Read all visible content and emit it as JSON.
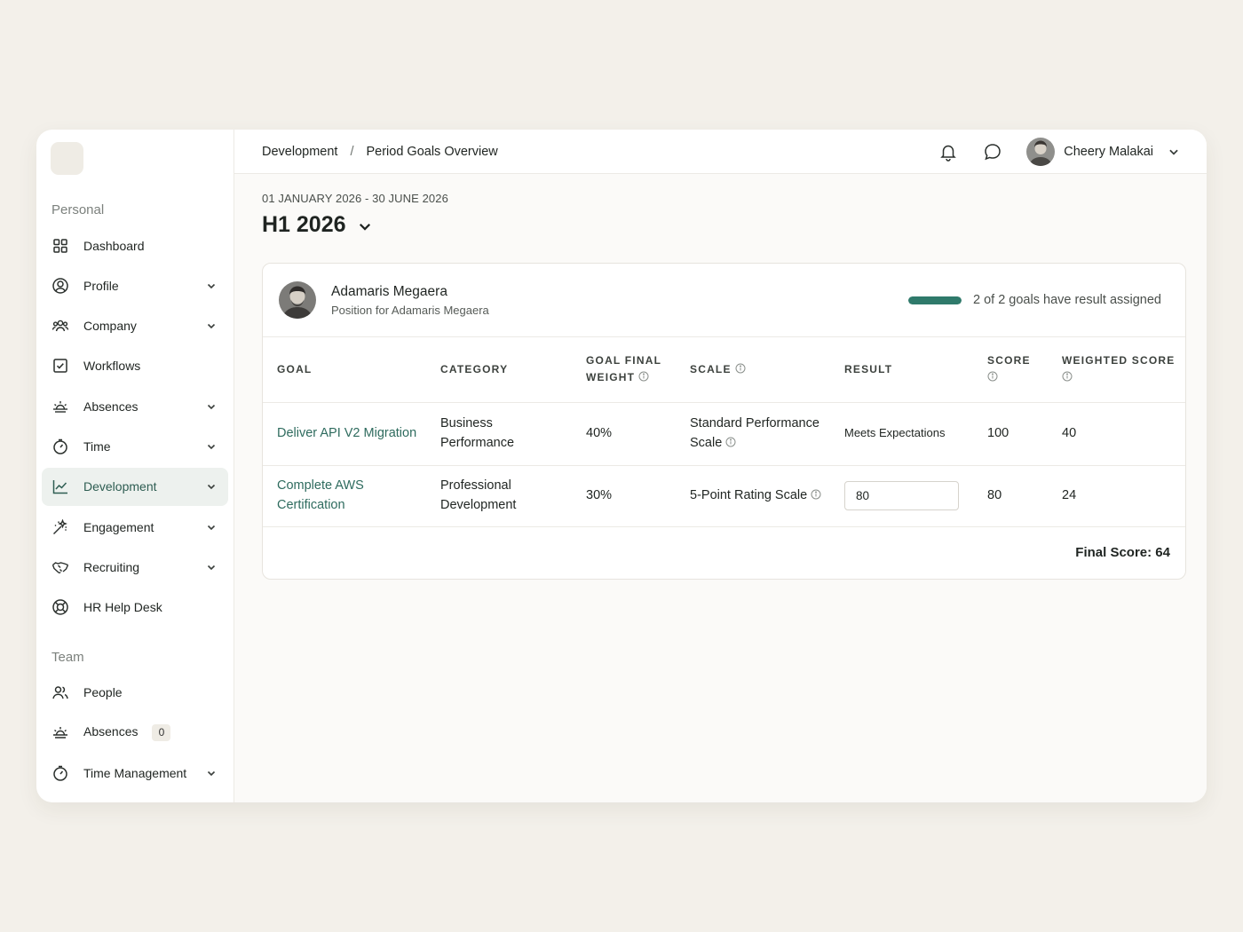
{
  "breadcrumb": {
    "parent": "Development",
    "separator": "/",
    "current": "Period Goals Overview"
  },
  "user": {
    "name": "Cheery Malakai"
  },
  "sidebar": {
    "personal_label": "Personal",
    "team_label": "Team",
    "personal_items": [
      {
        "label": "Dashboard",
        "icon": "grid-icon"
      },
      {
        "label": "Profile",
        "icon": "user-circle-icon"
      },
      {
        "label": "Company",
        "icon": "users-icon"
      },
      {
        "label": "Workflows",
        "icon": "checkbox-icon"
      },
      {
        "label": "Absences",
        "icon": "sunrise-icon"
      },
      {
        "label": "Time",
        "icon": "stopwatch-icon"
      },
      {
        "label": "Development",
        "icon": "chart-line-icon"
      },
      {
        "label": "Engagement",
        "icon": "sparkle-icon"
      },
      {
        "label": "Recruiting",
        "icon": "handshake-icon"
      },
      {
        "label": "HR Help Desk",
        "icon": "lifebuoy-icon"
      }
    ],
    "team_items": [
      {
        "label": "People",
        "icon": "users-icon"
      },
      {
        "label": "Absences",
        "icon": "sunrise-icon",
        "badge": "0"
      },
      {
        "label": "Time Management",
        "icon": "stopwatch-icon"
      }
    ]
  },
  "period": {
    "range": "01 JANUARY 2026 - 30 JUNE 2026",
    "title": "H1 2026"
  },
  "employee": {
    "name": "Adamaris Megaera",
    "position": "Position for Adamaris Megaera"
  },
  "progress": {
    "text": "2 of 2 goals have result assigned",
    "assigned": 2,
    "total": 2,
    "color": "#2f7a6b"
  },
  "table": {
    "headers": {
      "goal": "GOAL",
      "category": "CATEGORY",
      "weight": "GOAL FINAL WEIGHT",
      "scale": "SCALE",
      "result": "RESULT",
      "score": "SCORE",
      "weighted": "WEIGHTED SCORE"
    },
    "rows": [
      {
        "goal": "Deliver API V2 Migration",
        "category": "Business Performance",
        "weight": "40%",
        "scale": "Standard Performance Scale",
        "result": "Meets Expectations",
        "score": "100",
        "weighted": "40"
      },
      {
        "goal": "Complete AWS Certification",
        "category": "Professional Development",
        "weight": "30%",
        "scale": "5-Point Rating Scale",
        "result": "80",
        "score": "80",
        "weighted": "24"
      }
    ]
  },
  "final_score": "Final Score: 64",
  "colors": {
    "accent": "#2e6b5e",
    "active_bg": "#edf1ee",
    "page_bg": "#f3f0ea"
  }
}
